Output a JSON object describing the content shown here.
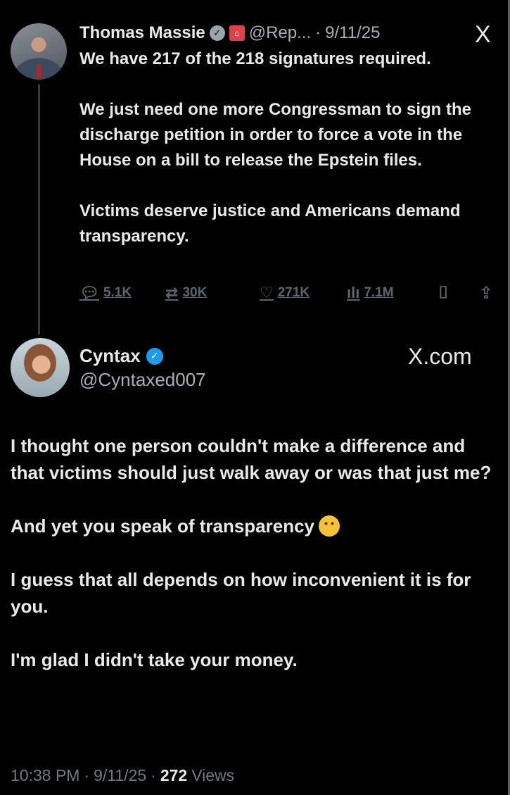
{
  "parent_tweet": {
    "author_name": "Thomas Massie",
    "verified_badge": "grey-check-icon",
    "affiliation_badge": "capitol-icon",
    "handle_truncated": "@Rep...",
    "separator": "·",
    "date": "9/11/25",
    "platform_logo": "X",
    "paragraphs": [
      "We have 217 of the 218 signatures required.",
      "We just need one more Congressman to sign the discharge petition in order to force a vote in the House on a bill to release the Epstein files.",
      "Victims deserve justice and Americans demand transparency."
    ],
    "actions": {
      "replies": "5.1K",
      "reposts": "30K",
      "likes": "271K",
      "views": "7.1M"
    }
  },
  "reply_tweet": {
    "author_name": "Cyntax",
    "verified_badge": "blue-check-icon",
    "handle": "@Cyntaxed007",
    "watermark": "X.com",
    "paragraphs": [
      "I thought one person couldn't make a difference and that victims should just walk away or was that just me?",
      "And yet you speak of transparency",
      "I guess that all depends on how inconvenient it is for you.",
      "I'm glad I didn't take your money."
    ],
    "emoji": "thinking-face-icon",
    "footer": {
      "time": "10:38 PM",
      "separator": "·",
      "date": "9/11/25",
      "views_count": "272",
      "views_label": "Views"
    }
  }
}
